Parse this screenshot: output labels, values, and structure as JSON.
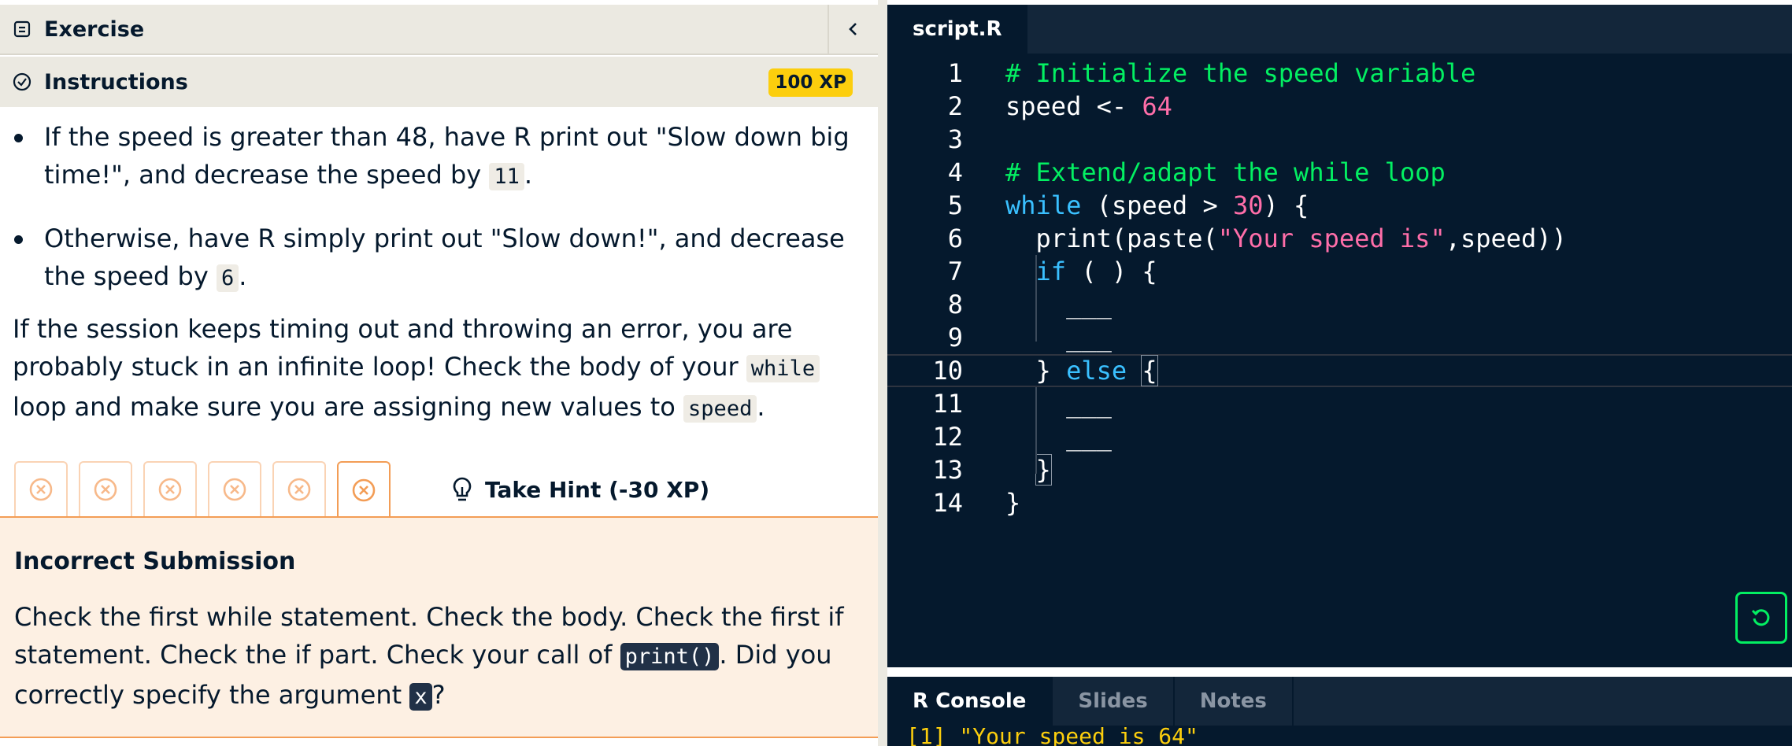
{
  "exercise_header": {
    "title": "Exercise",
    "collapse_icon": "chevron-left-icon"
  },
  "instructions_header": {
    "title": "Instructions",
    "xp": "100 XP"
  },
  "instructions": {
    "bullet1": {
      "pre": "If the speed is greater than 48, have R print out \"Slow down big time!\", and decrease the speed by ",
      "code": "11",
      "post": "."
    },
    "bullet2": {
      "pre": "Otherwise, have R simply print out \"Slow down!\", and decrease the speed by ",
      "code": "6",
      "post": "."
    },
    "note": {
      "pre": "If the session keeps timing out and throwing an error, you are probably stuck in an infinite loop! Check the body of your ",
      "code1": "while",
      "mid": " loop and make sure you are assigning new values to ",
      "code2": "speed",
      "post": "."
    }
  },
  "attempts": {
    "count": 6,
    "icon": "x-circle-icon"
  },
  "hint_button": {
    "label": "Take Hint (-30 XP)",
    "icon": "lightbulb-icon"
  },
  "feedback": {
    "title": "Incorrect Submission",
    "pre": "Check the first while statement. Check the body. Check the first if statement. Check the if part. Check your call of ",
    "code1": "print()",
    "mid": ". Did you correctly specify the argument ",
    "code2": "x",
    "post": "?"
  },
  "editor": {
    "tab": "script.R",
    "lines": [
      {
        "n": "1"
      },
      {
        "n": "2"
      },
      {
        "n": "3"
      },
      {
        "n": "4"
      },
      {
        "n": "5"
      },
      {
        "n": "6"
      },
      {
        "n": "7"
      },
      {
        "n": "8"
      },
      {
        "n": "9"
      },
      {
        "n": "10"
      },
      {
        "n": "11"
      },
      {
        "n": "12"
      },
      {
        "n": "13"
      },
      {
        "n": "14"
      }
    ],
    "code": {
      "l1": "# Initialize the speed variable",
      "l2a": "speed <- ",
      "l2b": "64",
      "l4": "# Extend/adapt the while loop",
      "l5a": "while",
      "l5b": " (speed > ",
      "l5c": "30",
      "l5d": ") {",
      "l6a": "  print(paste(",
      "l6b": "\"Your speed is\"",
      "l6c": ",speed))",
      "l7a": "  ",
      "l7b": "if",
      "l7c": " ( ) {",
      "l8": "    ___",
      "l9": "    ___",
      "l10a": "  } ",
      "l10b": "else",
      "l10c": " ",
      "l10d": "{",
      "l11": "    ___",
      "l12": "    ___",
      "l13a": "  ",
      "l13b": "}",
      "l14": "}"
    },
    "reset_icon": "reset-icon"
  },
  "console": {
    "tabs": [
      "R Console",
      "Slides",
      "Notes"
    ],
    "output": "[1] \"Your speed is 64\""
  }
}
